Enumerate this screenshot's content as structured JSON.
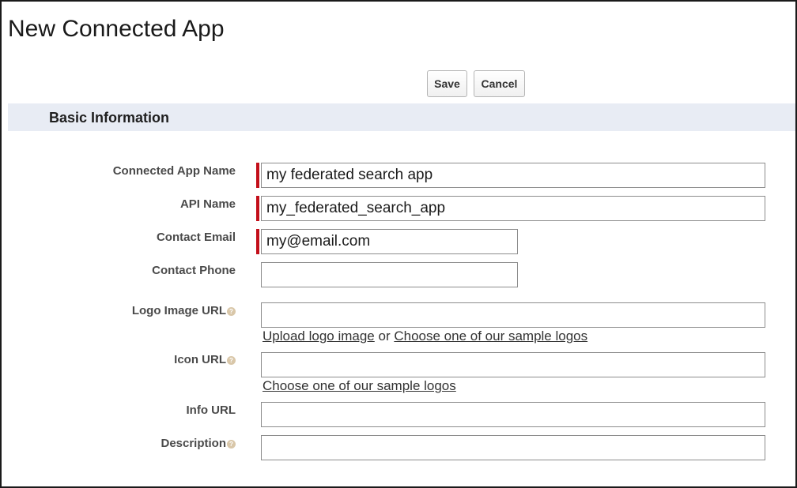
{
  "page": {
    "title": "New Connected App"
  },
  "toolbar": {
    "save_label": "Save",
    "cancel_label": "Cancel"
  },
  "section": {
    "title": "Basic Information"
  },
  "fields": {
    "connected_app_name": {
      "label": "Connected App Name",
      "value": "my federated search app",
      "required": true
    },
    "api_name": {
      "label": "API Name",
      "value": "my_federated_search_app",
      "required": true
    },
    "contact_email": {
      "label": "Contact Email",
      "value": "my@email.com",
      "required": true
    },
    "contact_phone": {
      "label": "Contact Phone",
      "value": "",
      "required": false
    },
    "logo_image_url": {
      "label": "Logo Image URL",
      "value": "",
      "has_help": true
    },
    "icon_url": {
      "label": "Icon URL",
      "value": "",
      "has_help": true
    },
    "info_url": {
      "label": "Info URL",
      "value": ""
    },
    "description": {
      "label": "Description",
      "value": "",
      "has_help": true
    }
  },
  "links": {
    "upload_logo": "Upload logo image",
    "or_text": "or",
    "sample_logos": "Choose one of our sample logos",
    "icon_sample_logos": "Choose one of our sample logos"
  },
  "colors": {
    "required_bar": "#c30f1a",
    "section_bg": "#e8ecf4"
  },
  "icons": {
    "help": "help-icon"
  }
}
